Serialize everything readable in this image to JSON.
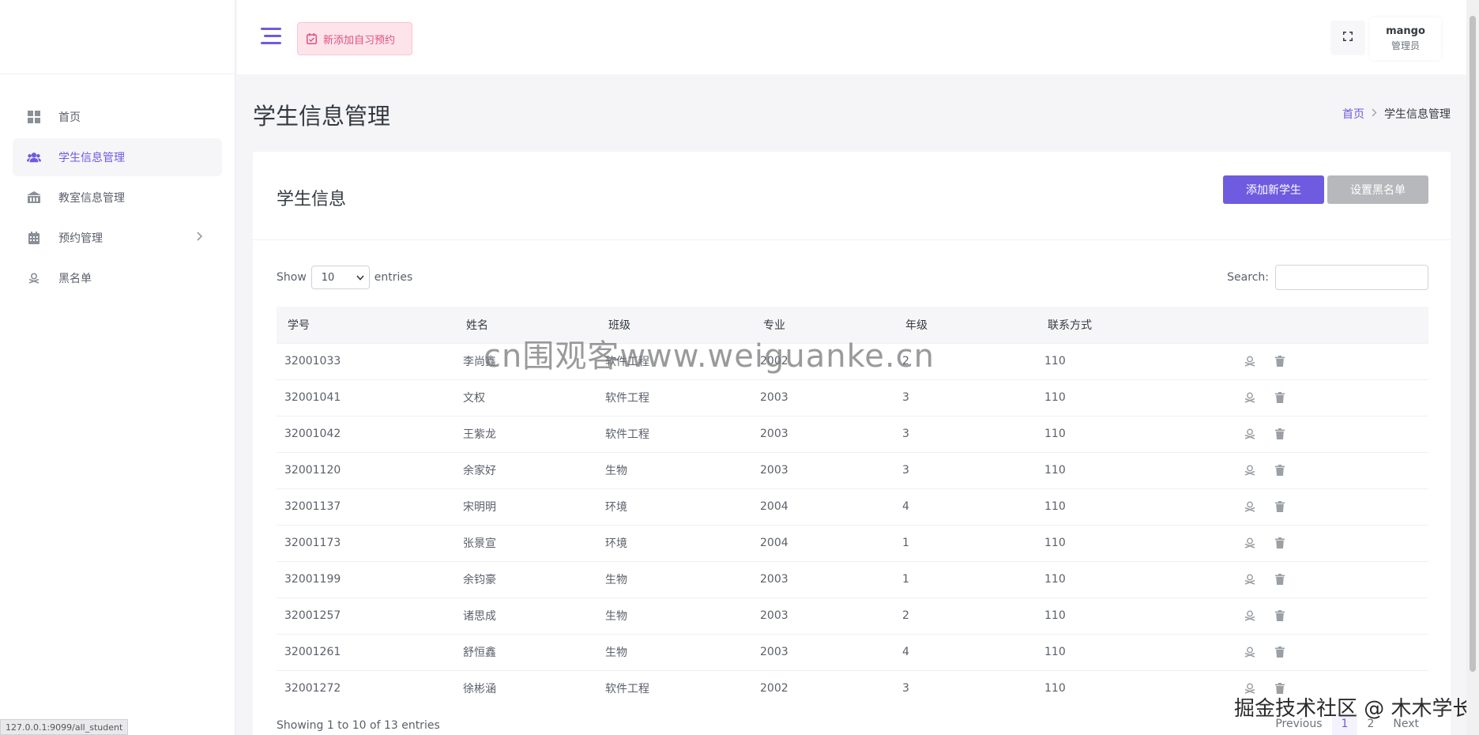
{
  "sidebar": {
    "items": [
      {
        "label": "首页",
        "icon": "dashboard-icon",
        "active": false
      },
      {
        "label": "学生信息管理",
        "icon": "users-icon",
        "active": true
      },
      {
        "label": "教室信息管理",
        "icon": "classroom-icon",
        "active": false
      },
      {
        "label": "预约管理",
        "icon": "calendar-icon",
        "active": false,
        "has_submenu": true
      },
      {
        "label": "黑名单",
        "icon": "blacklist-icon",
        "active": false
      }
    ]
  },
  "topbar": {
    "booking_button": "新添加自习预约",
    "user_name": "mango",
    "user_role": "管理员"
  },
  "page": {
    "title": "学生信息管理",
    "breadcrumb_home": "首页",
    "breadcrumb_current": "学生信息管理"
  },
  "card": {
    "title": "学生信息",
    "add_button": "添加新学生",
    "blacklist_button": "设置黑名单"
  },
  "datatable": {
    "show_label": "Show",
    "length_value": "10",
    "entries_label": "entries",
    "search_label": "Search:",
    "search_value": "",
    "columns": [
      "学号",
      "姓名",
      "班级",
      "专业",
      "年级",
      "联系方式"
    ],
    "rows": [
      [
        "32001033",
        "李尚鑫",
        "软件工程",
        "2002",
        "2",
        "110"
      ],
      [
        "32001041",
        "文权",
        "软件工程",
        "2003",
        "3",
        "110"
      ],
      [
        "32001042",
        "王紫龙",
        "软件工程",
        "2003",
        "3",
        "110"
      ],
      [
        "32001120",
        "余家好",
        "生物",
        "2003",
        "3",
        "110"
      ],
      [
        "32001137",
        "宋明明",
        "环境",
        "2004",
        "4",
        "110"
      ],
      [
        "32001173",
        "张景宣",
        "环境",
        "2004",
        "1",
        "110"
      ],
      [
        "32001199",
        "余钧豪",
        "生物",
        "2003",
        "1",
        "110"
      ],
      [
        "32001257",
        "诸思成",
        "生物",
        "2003",
        "2",
        "110"
      ],
      [
        "32001261",
        "舒恒鑫",
        "生物",
        "2003",
        "4",
        "110"
      ],
      [
        "32001272",
        "徐彬涵",
        "软件工程",
        "2002",
        "3",
        "110"
      ]
    ],
    "info": "Showing 1 to 10 of 13 entries",
    "pagination": {
      "previous": "Previous",
      "pages": [
        "1",
        "2"
      ],
      "current": "1",
      "next": "Next"
    }
  },
  "overlay": {
    "watermark": "cn围观客www.weiguanke.cn",
    "corner_watermark": "掘金技术社区 @ 木木学长",
    "status_url": "127.0.0.1:9099/all_student"
  },
  "colors": {
    "accent": "#6e5be0",
    "booking_bg": "#fde4ea",
    "blacklist_btn": "#b7b8bb"
  }
}
